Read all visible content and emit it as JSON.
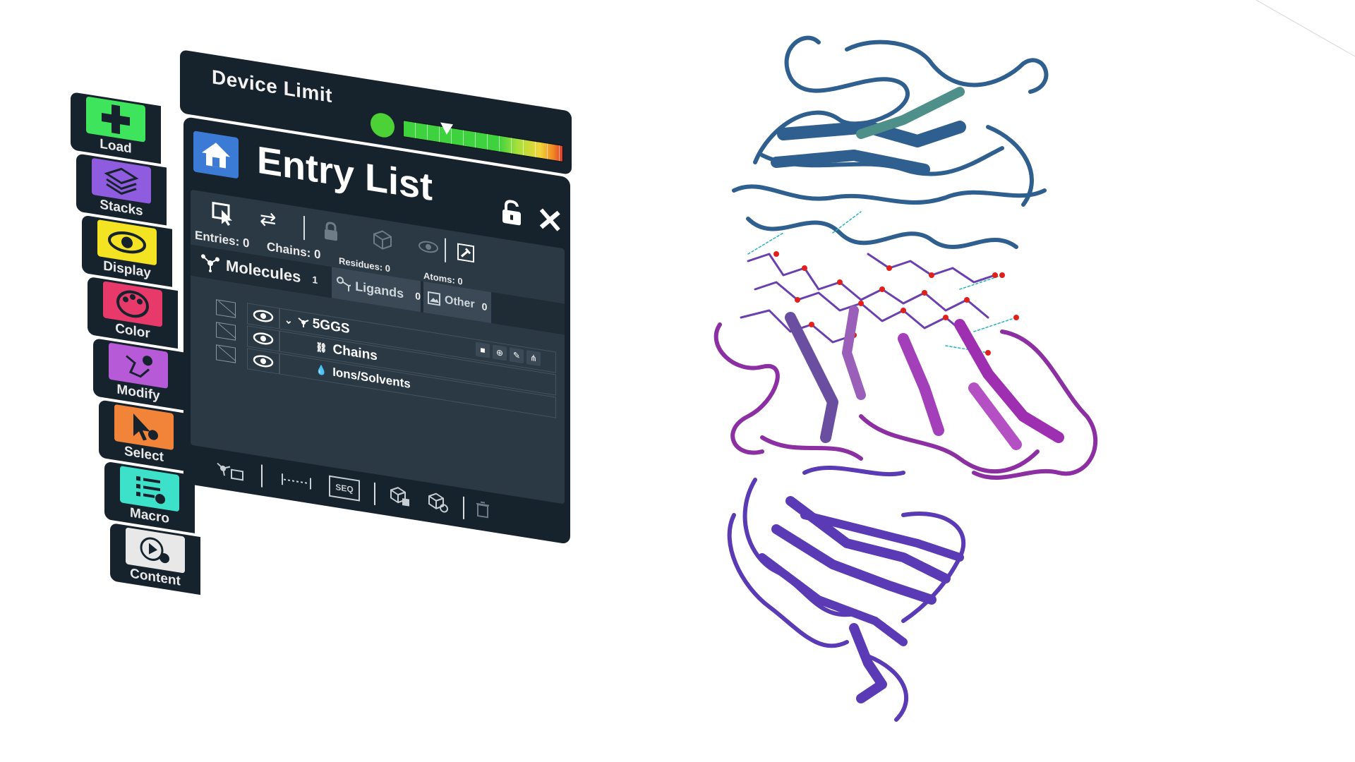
{
  "device_limit": {
    "label": "Device Limit",
    "level_fraction": 0.27
  },
  "sidebar": {
    "items": [
      {
        "label": "Load",
        "icon": "plus-icon",
        "color": "#3ee45c"
      },
      {
        "label": "Stacks",
        "icon": "layers-icon",
        "color": "#8f5ce0"
      },
      {
        "label": "Display",
        "icon": "eye-icon",
        "color": "#f3e322"
      },
      {
        "label": "Color",
        "icon": "palette-icon",
        "color": "#e83a6a"
      },
      {
        "label": "Modify",
        "icon": "molecule-edit-icon",
        "color": "#b65ad8"
      },
      {
        "label": "Select",
        "icon": "select-cursor-icon",
        "color": "#f2843a"
      },
      {
        "label": "Macro",
        "icon": "macro-list-icon",
        "color": "#3de0c9"
      },
      {
        "label": "Content",
        "icon": "content-play-icon",
        "color": "#e8e8e8"
      }
    ]
  },
  "panel": {
    "title": "Entry List",
    "stats": {
      "entries": "Entries: 0",
      "chains": "Chains: 0",
      "residues": "Residues: 0",
      "atoms": "Atoms: 0"
    },
    "tabs": [
      {
        "label": "Molecules",
        "count": "1"
      },
      {
        "label": "Ligands",
        "count": "0"
      },
      {
        "label": "Other",
        "count": "0"
      }
    ],
    "entries": [
      {
        "name": "5GGS"
      },
      {
        "name": "Chains"
      },
      {
        "name": "Ions/Solvents"
      }
    ],
    "footer": {
      "seq_label": "SEQ"
    }
  },
  "colors": {
    "panel_bg": "#16222c",
    "body_bg": "#2b3944",
    "accent_home": "#3b7bd6",
    "protein_top": "#2e5f8e",
    "protein_mid": "#8b2fa3",
    "protein_bottom": "#5a3bb5"
  }
}
